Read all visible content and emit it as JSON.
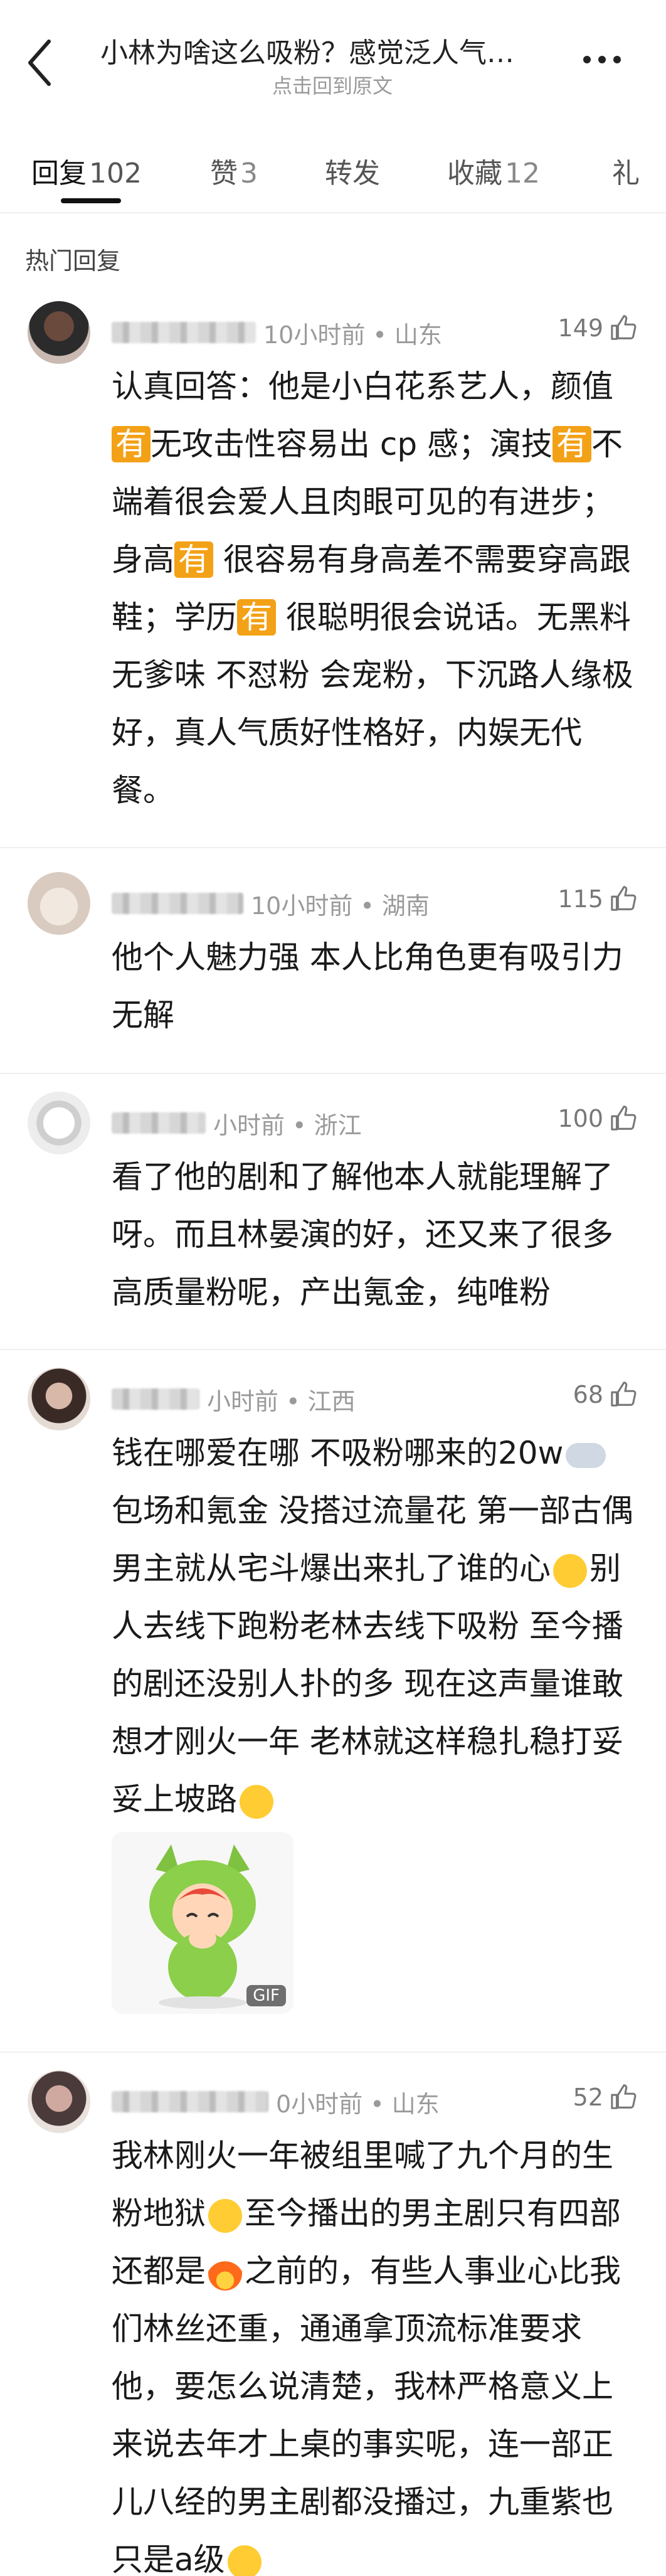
{
  "header": {
    "title": "小林为啥这么吸粉？感觉泛人气…",
    "subtitle": "点击回到原文"
  },
  "tabs": [
    {
      "label": "回复",
      "count": "102"
    },
    {
      "label": "赞",
      "count": "3"
    },
    {
      "label": "转发",
      "count": ""
    },
    {
      "label": "收藏",
      "count": "12"
    },
    {
      "label": "礼",
      "count": ""
    }
  ],
  "section_label": "热门回复",
  "comments": [
    {
      "time_location": "10小时前 • 山东",
      "likes": "149",
      "text": [
        "认真回答：他是小白花系艺人，颜值",
        "有",
        "无攻击性容易出 cp 感；演技",
        "有",
        "不端着很会爱人且肉眼可见的有进步；身高",
        "有",
        " 很容易有身高差不需要穿高跟鞋；学历",
        "有",
        " 很聪明很会说话。无黑料 无爹味 不怼粉 会宠粉，下沉路人缘极好，真人气质好性格好，内娱无代餐。"
      ]
    },
    {
      "time_location": "10小时前 • 湖南",
      "likes": "115",
      "text": "他个人魅力强 本人比角色更有吸引力 无解"
    },
    {
      "time_location": "小时前 • 浙江",
      "likes": "100",
      "text": "看了他的剧和了解他本人就能理解了呀。而且林晏演的好，还又来了很多高质量粉呢，产出氪金，纯唯粉"
    },
    {
      "time_location": "小时前 • 江西",
      "likes": "68",
      "text_a": "钱在哪爱在哪 不吸粉哪来的20w",
      "text_b": "包场和氪金 没搭过流量花 第一部古偶男主就从宅斗爆出来扎了谁的心",
      "text_c": "别人去线下跑粉老林去线下吸粉 至今播的剧还没别人扑的多 现在这声量谁敢想才刚火一年 老林就这样稳扎稳打妥妥上坡路",
      "gif_label": "GIF"
    },
    {
      "time_location": "0小时前 • 山东",
      "likes": "52",
      "text_a": "我林刚火一年被组里喊了九个月的生粉地狱",
      "text_b": "至今播出的男主剧只有四部还都是",
      "text_c": "之前的，有些人事业心比我们林丝还重，通通拿顶流标准要求他，要怎么说清楚，我林严格意义上来说去年才上桌的事实呢，连一部正儿八经的男主剧都没播过，九重紫也只是a级"
    }
  ]
}
